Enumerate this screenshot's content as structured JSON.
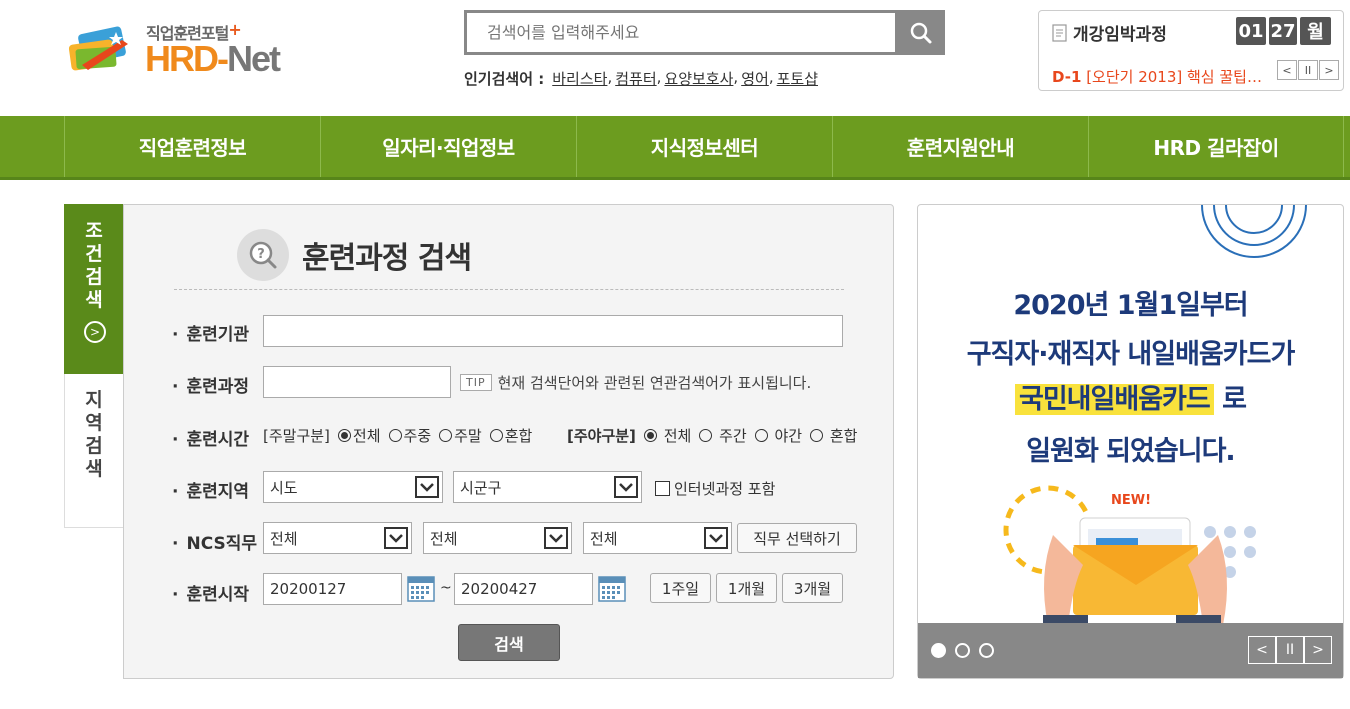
{
  "header": {
    "logo_sub": "직업훈련포털",
    "logo_plus": "+",
    "logo_hrd": "HRD",
    "logo_dash": "-",
    "logo_net": "Net",
    "search_placeholder": "검색어를 입력해주세요",
    "popular_label": "인기검색어 :",
    "popular_terms": [
      "바리스타",
      "컴퓨터",
      "요양보호사",
      "영어",
      "포토샵"
    ],
    "popular_sep": ","
  },
  "upcoming": {
    "title": "개강임박과정",
    "month": "01",
    "day": "27",
    "weekday": "월",
    "dday": "D-1",
    "course": "[오단기 2013] 핵심 꿀팁…",
    "prev": "<",
    "pause": "II",
    "next": ">"
  },
  "nav": {
    "items": [
      "직업훈련정보",
      "일자리·직업정보",
      "지식정보센터",
      "훈련지원안내",
      "HRD 길라잡이"
    ]
  },
  "tabs": {
    "condition": "조\n건\n검\n색",
    "condition_arrow": ">",
    "region": "지\n역\n검\n색"
  },
  "form": {
    "title": "훈련과정 검색",
    "org_label": "훈련기관",
    "org_value": "",
    "course_label": "훈련과정",
    "course_value": "",
    "tip_label": "TIP",
    "tip_text": "현재 검색단어와 관련된 연관검색어가 표시됩니다.",
    "time_label": "훈련시간",
    "weekend_group": "[주말구분]",
    "weekend_options": [
      "전체",
      "주중",
      "주말",
      "혼합"
    ],
    "weekend_selected": "전체",
    "daynight_group": "[주야구분]",
    "daynight_options": [
      "전체",
      "주간",
      "야간",
      "혼합"
    ],
    "daynight_selected": "전체",
    "region_label": "훈련지역",
    "sido": "시도",
    "sigungu": "시군구",
    "internet_label": "인터넷과정 포함",
    "ncs_label": "NCS직무",
    "ncs1": "전체",
    "ncs2": "전체",
    "ncs3": "전체",
    "ncs_btn": "직무 선택하기",
    "start_label": "훈련시작",
    "start_from": "20200127",
    "tilde": "~",
    "start_to": "20200427",
    "period_btns": [
      "1주일",
      "1개월",
      "3개월"
    ],
    "submit": "검색"
  },
  "banner": {
    "line1": "2020년 1월1일부터",
    "line2": "구직자·재직자 내일배움카드가",
    "line3_hl": "국민내일배움카드",
    "line3_rest": "로",
    "line4": "일원화 되었습니다.",
    "new_badge": "NEW!",
    "prev": "<",
    "pause": "II",
    "next": ">",
    "slide_count": 3,
    "active_slide": 1
  },
  "colors": {
    "nav_green": "#6c9c1f",
    "tab_green": "#5a8a1a",
    "logo_orange": "#f08a1c",
    "dday_red": "#e8471c",
    "banner_navy": "#1d3a7a",
    "banner_yellow": "#f9e23c"
  }
}
